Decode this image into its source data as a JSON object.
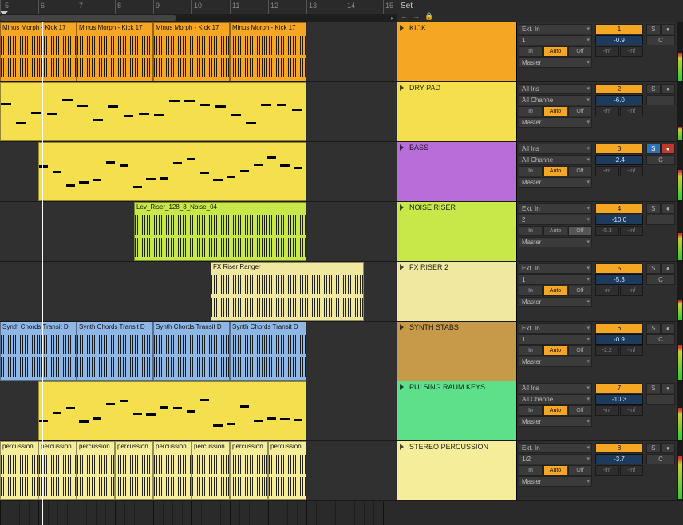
{
  "ruler": {
    "start": 5,
    "end": 15,
    "playhead_bar": 6.1
  },
  "set": {
    "label": "Set",
    "icons": [
      "←",
      "→",
      "🔒"
    ]
  },
  "clips": {
    "kick": "Minus Morph - Kick 17",
    "riser": "Lev_Riser_128_8_Noise_04",
    "fx": "FX Riser Ranger",
    "synth": "Synth Chords Transit D",
    "perc": "percussion"
  },
  "colors": {
    "orange": "#f5a623",
    "yellow": "#f4e04d",
    "purple": "#b96dd9",
    "lime": "#c8e84a",
    "cream": "#f0e8a0",
    "blue": "#8fb7e6",
    "green": "#5ee08a",
    "tan": "#c79a4a",
    "paleyellow": "#f5ed9a"
  },
  "tracks": [
    {
      "name": "KICK",
      "color": "orange",
      "number": 1,
      "input": "Ext. In",
      "input_ch": "1",
      "monitor": "Auto",
      "output": "Master",
      "vol": "-0.9",
      "pan": "C",
      "send_a": "-inf",
      "send_b": "-inf",
      "solo": false,
      "rec": false
    },
    {
      "name": "DRY PAD",
      "color": "yellow",
      "number": 2,
      "input": "All Ins",
      "input_ch": "All Channe",
      "monitor": "Auto",
      "output": "Master",
      "vol": "-6.0",
      "pan": "",
      "send_a": "-inf",
      "send_b": "-inf",
      "solo": false,
      "rec": false
    },
    {
      "name": "BASS",
      "color": "purple",
      "number": 3,
      "input": "All Ins",
      "input_ch": "All Channe",
      "monitor": "Auto",
      "output": "Master",
      "vol": "-2.4",
      "pan": "C",
      "send_a": "-inf",
      "send_b": "-inf",
      "solo": true,
      "rec": true
    },
    {
      "name": "NOISE RISER",
      "color": "lime",
      "number": 4,
      "input": "Ext. In",
      "input_ch": "2",
      "monitor": "Off",
      "output": "Master",
      "vol": "-10.0",
      "pan": "",
      "send_a": "-5.3",
      "send_b": "-inf",
      "solo": false,
      "rec": false
    },
    {
      "name": "FX RISER 2",
      "color": "cream",
      "number": 5,
      "input": "Ext. In",
      "input_ch": "1",
      "monitor": "Auto",
      "output": "Master",
      "vol": "-5.3",
      "pan": "C",
      "send_a": "-inf",
      "send_b": "-inf",
      "solo": false,
      "rec": false
    },
    {
      "name": "SYNTH STABS",
      "color": "tan",
      "number": 6,
      "input": "Ext. In",
      "input_ch": "1",
      "monitor": "Auto",
      "output": "Master",
      "vol": "-0.9",
      "pan": "C",
      "send_a": "-2.2",
      "send_b": "-inf",
      "solo": false,
      "rec": false
    },
    {
      "name": "PULSING RAUM KEYS",
      "color": "green",
      "number": 7,
      "input": "All Ins",
      "input_ch": "All Channe",
      "monitor": "Auto",
      "output": "Master",
      "vol": "-10.3",
      "pan": "",
      "send_a": "-inf",
      "send_b": "-inf",
      "solo": false,
      "rec": false
    },
    {
      "name": "STEREO PERCUSSION",
      "color": "paleyellow",
      "number": 8,
      "input": "Ext. In",
      "input_ch": "1/2",
      "monitor": "Auto",
      "output": "Master",
      "vol": "-3.7",
      "pan": "C",
      "send_a": "-inf",
      "send_b": "-inf",
      "solo": false,
      "rec": false
    }
  ],
  "labels": {
    "in": "In",
    "auto": "Auto",
    "off": "Off",
    "solo": "S",
    "rec": "●",
    "pan_c": "C"
  }
}
